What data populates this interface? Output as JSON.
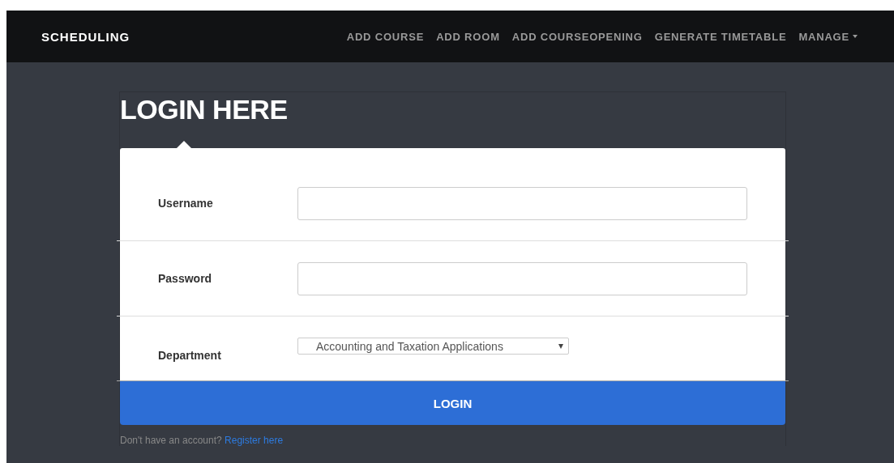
{
  "navbar": {
    "brand": "SCHEDULING",
    "items": [
      {
        "label": "ADD COURSE",
        "kind": "link"
      },
      {
        "label": "ADD ROOM",
        "kind": "link"
      },
      {
        "label": "ADD COURSEOPENING",
        "kind": "link"
      },
      {
        "label": "GENERATE TIMETABLE",
        "kind": "link"
      },
      {
        "label": "MANAGE",
        "kind": "dropdown"
      }
    ]
  },
  "panel": {
    "title": "LOGIN HERE",
    "fields": [
      {
        "label": "Username",
        "kind": "text"
      },
      {
        "label": "Password",
        "kind": "password"
      },
      {
        "label": "Department",
        "kind": "select",
        "value": "Accounting and Taxation Applications"
      }
    ],
    "submit": "LOGIN",
    "footer": {
      "text": "Don't have an account?",
      "link": "Register here"
    }
  }
}
